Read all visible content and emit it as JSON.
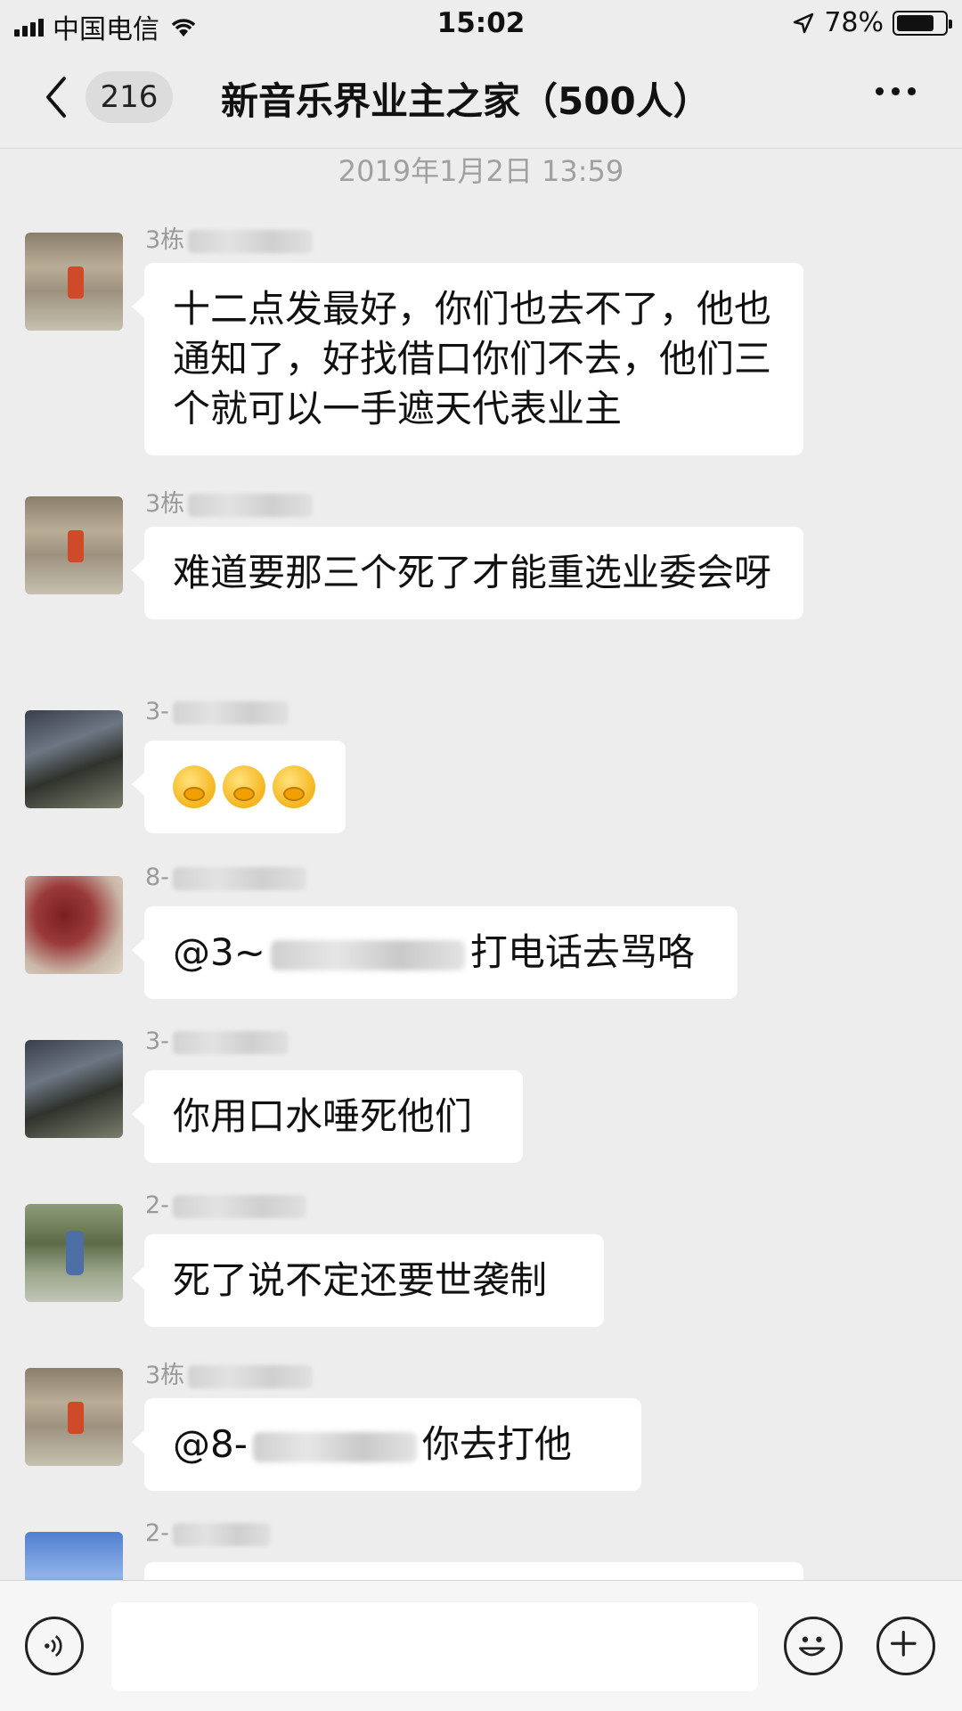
{
  "status_bar": {
    "carrier": "中国电信",
    "time": "15:02",
    "battery_percent": "78%",
    "battery_level": 0.78
  },
  "nav": {
    "unread_count": "216",
    "title": "新音乐界业主之家（500人）"
  },
  "chat": {
    "timestamp": "2019年1月2日 13:59",
    "messages": [
      {
        "sender": "3栋",
        "text": "十二点发最好，你们也去不了，他也通知了，好找借口你们不去，他们三个就可以一手遮天代表业主"
      },
      {
        "sender": "3栋",
        "text": "难道要那三个死了才能重选业委会呀"
      },
      {
        "sender": "3-",
        "text": ""
      },
      {
        "sender": "8-",
        "text_prefix": "@3~",
        "text_suffix": "打电话去骂咯"
      },
      {
        "sender": "3-",
        "text": "你用口水唾死他们"
      },
      {
        "sender": "2-",
        "text": "死了说不定还要世袭制"
      },
      {
        "sender": "3栋",
        "text_prefix": "@8-",
        "text_suffix": "你去打他"
      },
      {
        "sender": "2-",
        "text": ""
      }
    ]
  },
  "input": {
    "placeholder": ""
  },
  "icons": {
    "back": "chevron-left-icon",
    "more": "more-dots-icon",
    "voice": "voice-icon",
    "emoji": "emoji-icon",
    "plus": "plus-icon",
    "wifi": "wifi-icon",
    "location": "location-arrow-icon"
  }
}
